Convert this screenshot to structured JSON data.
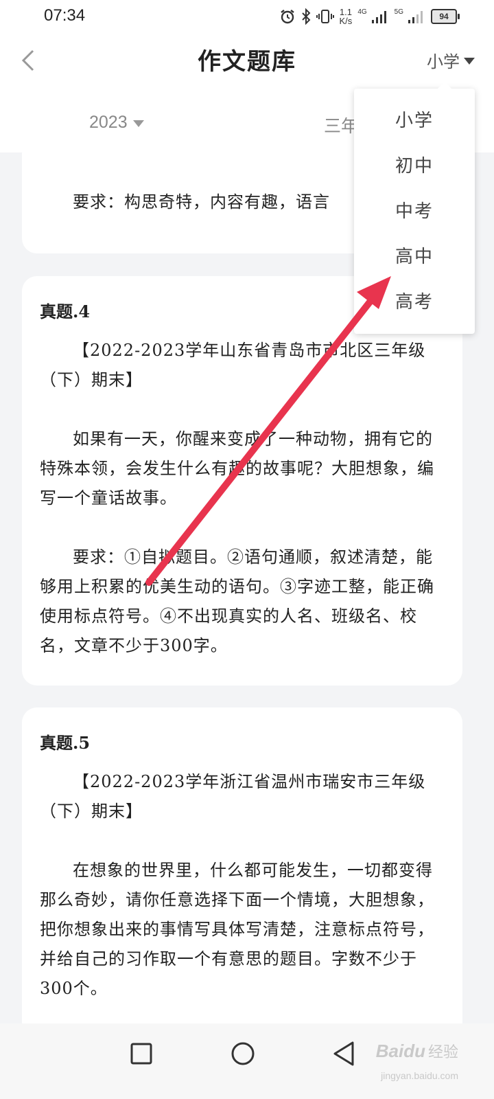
{
  "status_bar": {
    "time": "07:34",
    "net_speed_value": "1.1",
    "net_speed_unit": "K/s",
    "sig1_label": "4G",
    "sig2_label": "5G",
    "battery": "94"
  },
  "header": {
    "title": "作文题库",
    "level_selected": "小学"
  },
  "filters": {
    "year": "2023",
    "grade": "三年"
  },
  "cards": [
    {
      "requirement": "要求：构思奇特，内容有趣，语言"
    },
    {
      "title": "真题.4",
      "source": "【2022-2023学年山东省青岛市市北区三年级（下）期末】",
      "prompt": "如果有一天，你醒来变成了一种动物，拥有它的特殊本领，会发生什么有趣的故事呢？大胆想象，编写一个童话故事。",
      "requirement": "要求：①自拟题目。②语句通顺，叙述清楚，能够用上积累的优美生动的语句。③字迹工整，能正确使用标点符号。④不出现真实的人名、班级名、校名，文章不少于300字。"
    },
    {
      "title": "真题.5",
      "source": "【2022-2023学年浙江省温州市瑞安市三年级（下）期末】",
      "prompt": "在想象的世界里，什么都可能发生，一切都变得那么奇妙，请你任意选择下面一个情境，大胆想象，把你想象出来的事情写具体写清楚，注意标点符号，并给自己的习作取一个有意思的题目。字数不少于300个。"
    }
  ],
  "dropdown": {
    "options": [
      "小学",
      "初中",
      "中考",
      "高中",
      "高考"
    ]
  },
  "watermark": {
    "logo": "Baidu",
    "label": "经验",
    "url": "jingyan.baidu.com"
  },
  "colors": {
    "annotation_arrow": "#e8344e",
    "background": "#f3f4f6"
  }
}
